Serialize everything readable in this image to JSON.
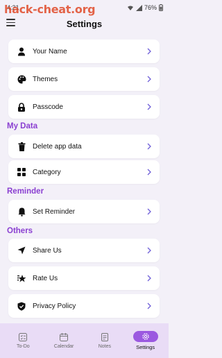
{
  "status_bar": {
    "time": "4:21",
    "battery": "76%"
  },
  "watermark": "hack-cheat.org",
  "header": {
    "title": "Settings"
  },
  "items": {
    "your_name": "Your Name",
    "themes": "Themes",
    "passcode": "Passcode",
    "delete_data": "Delete app data",
    "category": "Category",
    "set_reminder": "Set Reminder",
    "share_us": "Share Us",
    "rate_us": "Rate Us",
    "privacy_policy": "Privacy Policy"
  },
  "sections": {
    "my_data": "My Data",
    "reminder": "Reminder",
    "others": "Others"
  },
  "bottom_nav": {
    "todo": "To-Do",
    "calendar": "Calendar",
    "notes": "Notes",
    "settings": "Settings"
  },
  "colors": {
    "accent": "#8a3fd1",
    "nav_bg": "#e9dcf6",
    "active_pill": "#9b59e0"
  }
}
